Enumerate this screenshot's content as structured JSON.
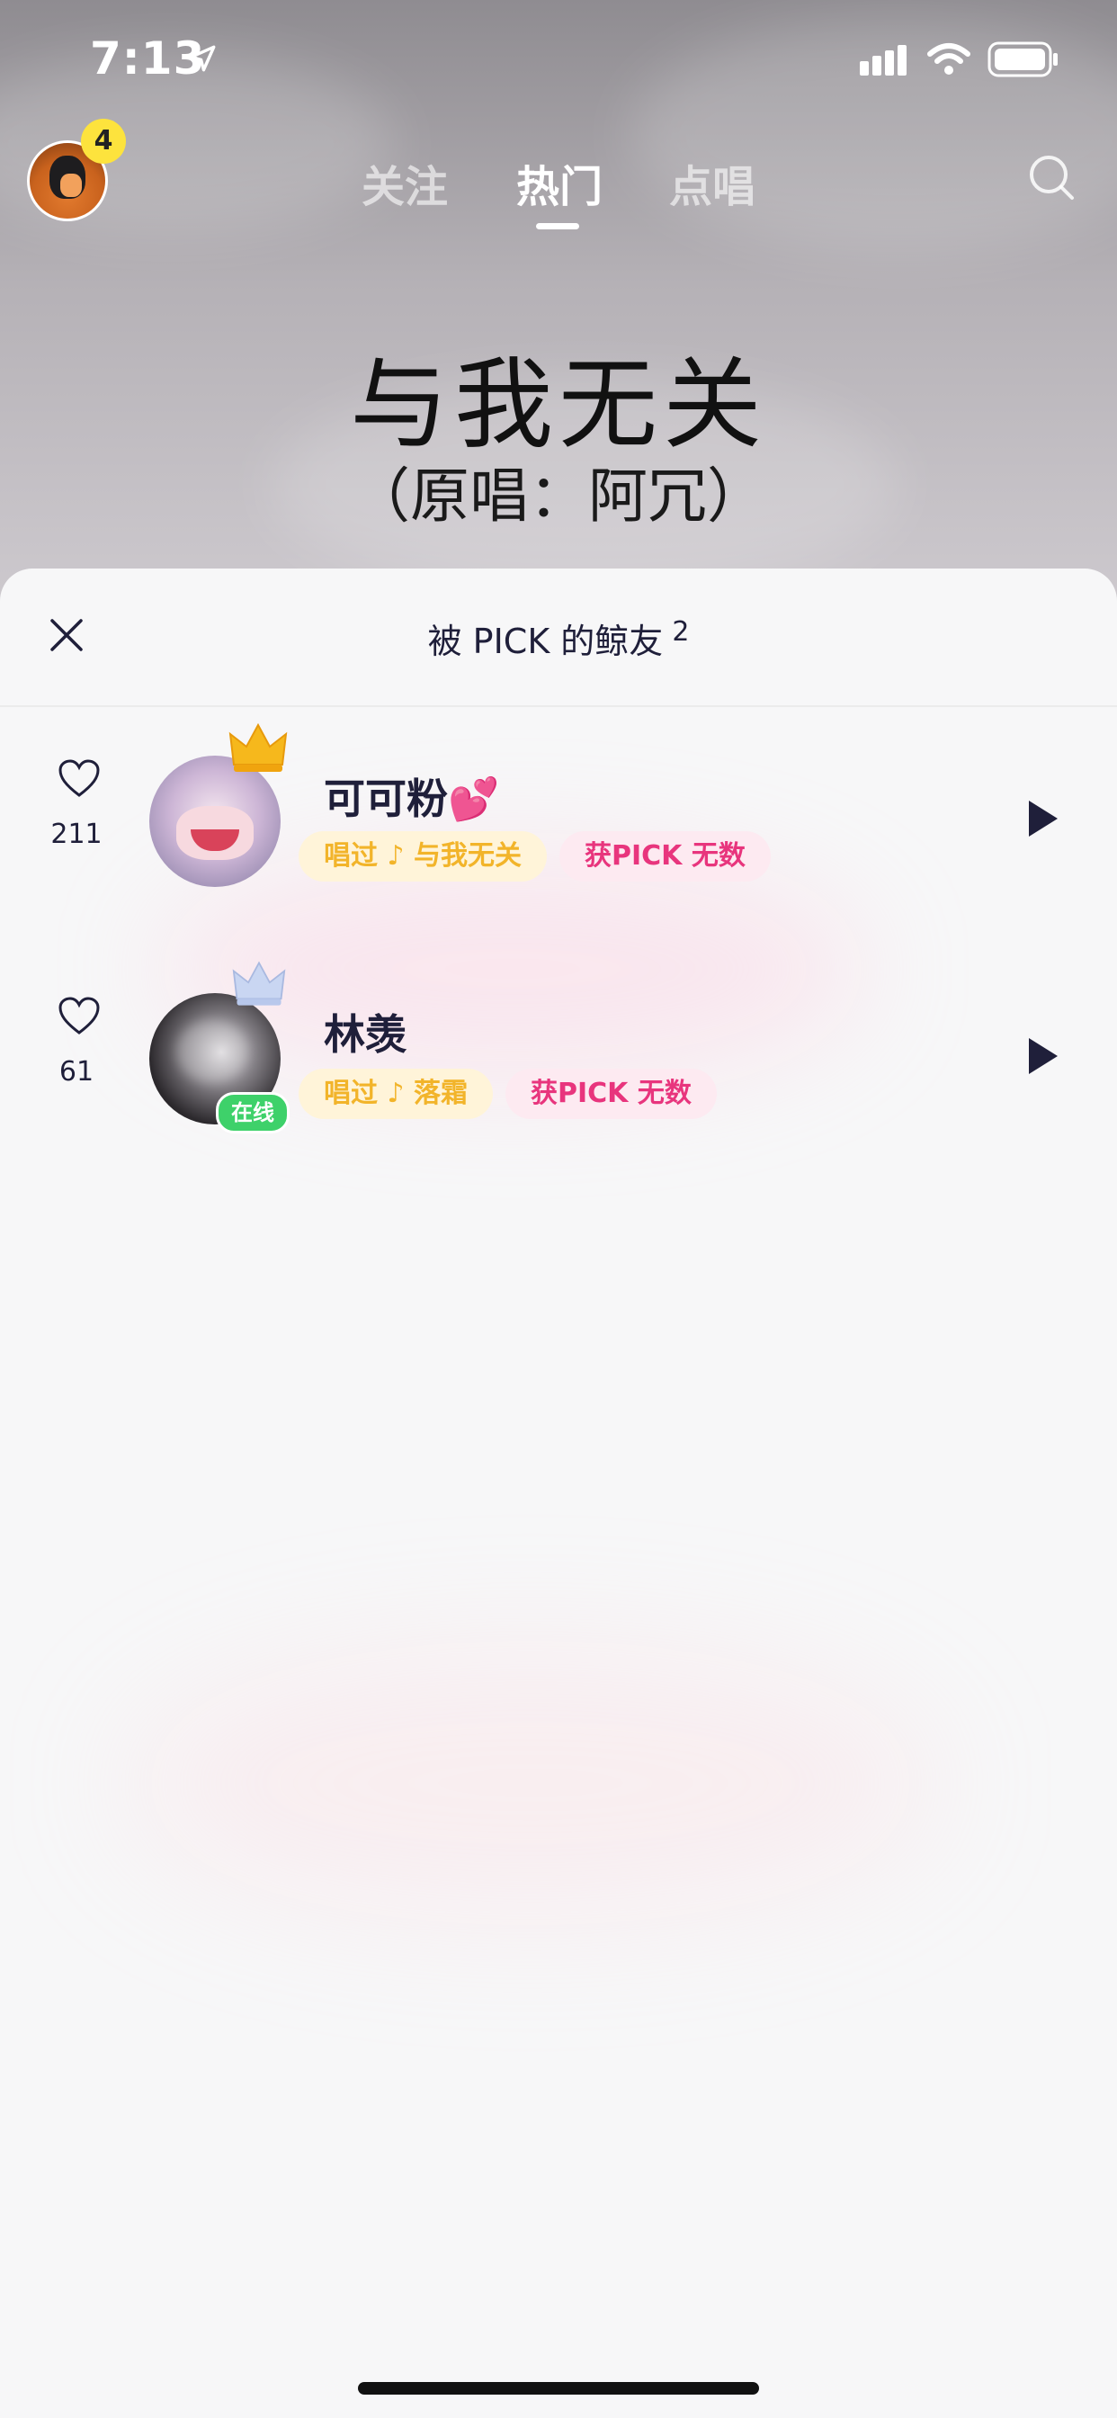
{
  "status_bar": {
    "time": "7:13"
  },
  "header": {
    "notification_count": "4",
    "tabs": [
      {
        "label": "关注",
        "active": false
      },
      {
        "label": "热门",
        "active": true
      },
      {
        "label": "点唱",
        "active": false
      }
    ]
  },
  "hero": {
    "title": "与我无关",
    "subtitle": "（原唱：阿冗）"
  },
  "sheet": {
    "title": "被 PICK 的鲸友",
    "count": "2",
    "users": [
      {
        "name": "可可粉",
        "emoji": "💕",
        "likes": "211",
        "sung_label": "唱过",
        "song": "与我无关",
        "pick_label": "获PICK 无数",
        "online": false,
        "crown": "gold"
      },
      {
        "name": "林羡",
        "emoji": "",
        "likes": "61",
        "sung_label": "唱过",
        "song": "落霜",
        "pick_label": "获PICK 无数",
        "online": true,
        "online_label": "在线",
        "crown": "silver"
      }
    ]
  },
  "colors": {
    "accent_pink": "#e8357d",
    "accent_gold": "#f2b42a",
    "online_green": "#3ed16a",
    "badge_yellow": "#fde33d"
  }
}
